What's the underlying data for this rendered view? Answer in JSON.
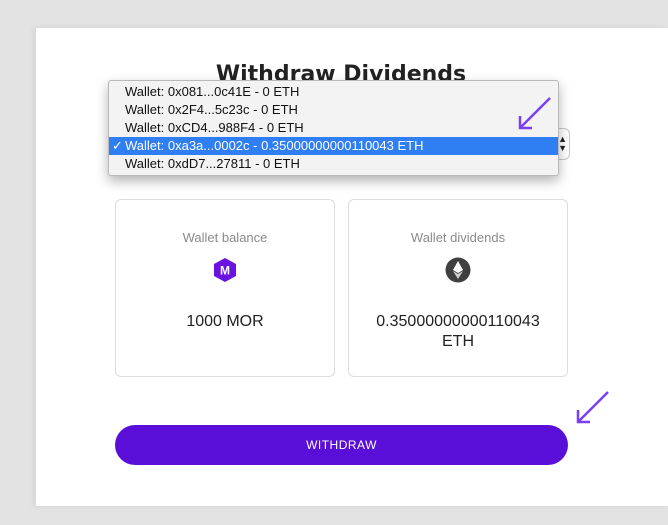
{
  "page": {
    "title": "Withdraw Dividends"
  },
  "wallet_select": {
    "options": [
      "Wallet: 0x081...0c41E - 0 ETH",
      "Wallet: 0x2F4...5c23c - 0 ETH",
      "Wallet: 0xCD4...988F4 - 0 ETH",
      "Wallet: 0xa3a...0002c - 0.35000000000110043 ETH",
      "Wallet: 0xdD7...27811 - 0 ETH"
    ],
    "selected_index": 3,
    "checkmark": "✓"
  },
  "balance_card": {
    "label": "Wallet balance",
    "icon": "mor-token-icon",
    "icon_letter": "M",
    "value": "1000 MOR"
  },
  "dividends_card": {
    "label": "Wallet dividends",
    "icon": "ethereum-icon",
    "value": "0.35000000000110043 ETH"
  },
  "actions": {
    "withdraw_label": "WITHDRAW"
  },
  "colors": {
    "accent": "#5a0fd8",
    "selection": "#2f7ff3",
    "annotation_arrow": "#7b3ff2"
  }
}
